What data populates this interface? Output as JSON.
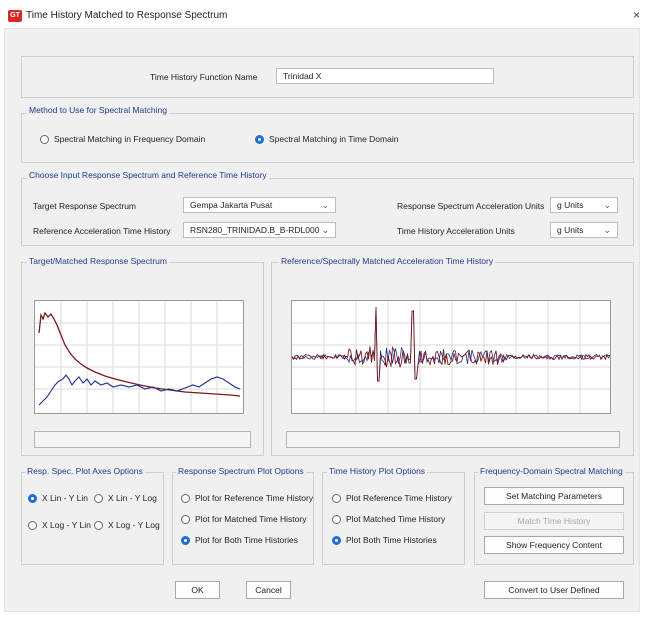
{
  "window": {
    "app_icon_text": "GT",
    "title": "Time History Matched to Response Spectrum",
    "close_glyph": "×"
  },
  "function_name": {
    "label": "Time History Function Name",
    "value": "Trinidad X"
  },
  "method": {
    "title": "Method to Use for Spectral Matching",
    "options": [
      "Spectral Matching in Frequency Domain",
      "Spectral Matching in Time Domain"
    ],
    "selected_index": 1
  },
  "inputs": {
    "title": "Choose Input Response Spectrum and Reference Time History",
    "target_rs_label": "Target Response Spectrum",
    "target_rs_value": "Gempa Jakarta Pusat",
    "ref_th_label": "Reference Acceleration Time History",
    "ref_th_value": "RSN280_TRINIDAD.B_B-RDL000",
    "rs_units_label": "Response Spectrum Acceleration Units",
    "rs_units_value": "g Units",
    "th_units_label": "Time History Acceleration Units",
    "th_units_value": "g Units"
  },
  "plots": {
    "spectrum_title": "Target/Matched Response Spectrum",
    "timehistory_title": "Reference/Spectrally Matched Acceleration Time History"
  },
  "axes_options": {
    "title": "Resp. Spec. Plot Axes Options",
    "options": [
      "X Lin - Y Lin",
      "X Lin - Y Log",
      "X Log - Y Lin",
      "X Log - Y Log"
    ],
    "selected_index": 0
  },
  "rs_plot_options": {
    "title": "Response Spectrum Plot Options",
    "options": [
      "Plot for Reference Time History",
      "Plot for Matched Time History",
      "Plot for Both Time Histories"
    ],
    "selected_index": 2
  },
  "th_plot_options": {
    "title": "Time History Plot Options",
    "options": [
      "Plot Reference Time History",
      "Plot Matched Time History",
      "Plot Both Time Histories"
    ],
    "selected_index": 2
  },
  "freq_domain": {
    "title": "Frequency-Domain Spectral Matching",
    "set_params": "Set Matching Parameters",
    "match_th": "Match Time History",
    "show_freq": "Show Frequency Content"
  },
  "footer": {
    "ok": "OK",
    "cancel": "Cancel",
    "convert": "Convert to User Defined"
  },
  "colors": {
    "accent": "#1f6fd1",
    "series_matched": "#7a1a1a",
    "series_reference": "#1e2f8a",
    "group_title": "#1e3a8a"
  }
}
